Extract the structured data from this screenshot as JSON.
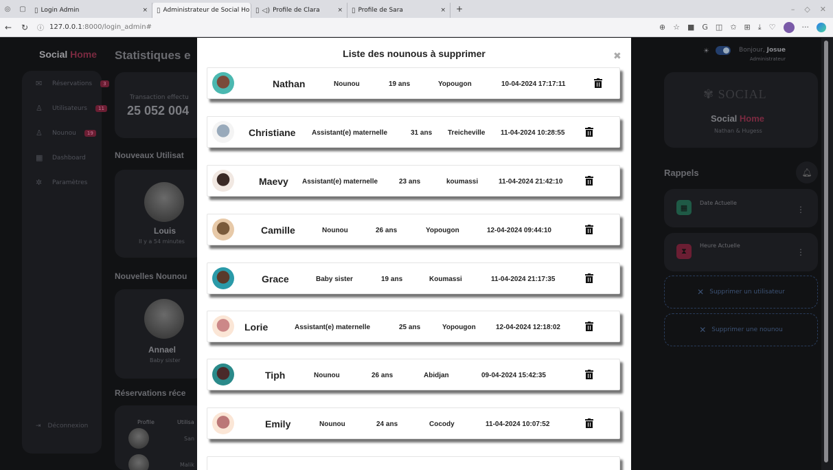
{
  "browser": {
    "tabs": [
      {
        "label": "Login Admin",
        "active": false
      },
      {
        "label": "Administrateur de Social Ho",
        "active": true
      },
      {
        "label": "Profile de Clara",
        "active": false
      },
      {
        "label": "Profile de Sara",
        "active": false
      }
    ],
    "url_host": "127.0.0.1",
    "url_path": ":8000/login_admin#"
  },
  "sidebar": {
    "brand_a": "Social",
    "brand_b": "Home",
    "items": [
      {
        "label": "Réservations",
        "badge": "3"
      },
      {
        "label": "Utilisateurs",
        "badge": "11"
      },
      {
        "label": "Nounou",
        "badge": "19"
      },
      {
        "label": "Dashboard",
        "badge": ""
      },
      {
        "label": "Paramètres",
        "badge": ""
      }
    ],
    "logout": "Déconnexion"
  },
  "main": {
    "title": "Statistiques e",
    "transaction_label": "Transaction effectu",
    "transaction_value": "25 052 004",
    "new_users_heading": "Nouveaux Utilisat",
    "new_user_name": "Louis",
    "new_user_time": "Il y a 54 minutes",
    "new_nannies_heading": "Nouvelles Nounou",
    "new_nanny_name": "Annael",
    "new_nanny_role": "Baby sister",
    "reservations_heading": "Réservations réce",
    "res_col_profile": "Profile",
    "res_col_user": "Utilisa",
    "res_row1": "San",
    "res_row2": "Malik"
  },
  "right": {
    "greeting_prefix": "Bonjour,",
    "user": "Josue",
    "role": "Administrateur",
    "brand_a": "Social",
    "brand_b": "Home",
    "brand_sub": "Nathan & Hugess",
    "rappels": "Rappels",
    "date_label": "Date Actuelle",
    "time_label": "Heure Actuelle",
    "delete_user": "Supprimer un utilisateur",
    "delete_nanny": "Supprimer une nounou"
  },
  "modal": {
    "title": "Liste des nounous à supprimer",
    "rows": [
      {
        "name": "Nathan",
        "role": "Nounou",
        "age": "19 ans",
        "city": "Yopougon",
        "date": "10-04-2024 17:17:11"
      },
      {
        "name": "Christiane",
        "role": "Assistant(e) maternelle",
        "age": "31 ans",
        "city": "Treicheville",
        "date": "11-04-2024 10:28:55"
      },
      {
        "name": "Maevy",
        "role": "Assistant(e) maternelle",
        "age": "23 ans",
        "city": "koumassi",
        "date": "11-04-2024 21:42:10"
      },
      {
        "name": "Camille",
        "role": "Nounou",
        "age": "26 ans",
        "city": "Yopougon",
        "date": "12-04-2024 09:44:10"
      },
      {
        "name": "Grace",
        "role": "Baby sister",
        "age": "19 ans",
        "city": "Koumassi",
        "date": "11-04-2024 21:17:35"
      },
      {
        "name": "Lorie",
        "role": "Assistant(e) maternelle",
        "age": "25 ans",
        "city": "Yopougon",
        "date": "12-04-2024 12:18:02"
      },
      {
        "name": "Tiph",
        "role": "Nounou",
        "age": "26 ans",
        "city": "Abidjan",
        "date": "09-04-2024 15:42:35"
      },
      {
        "name": "Emily",
        "role": "Nounou",
        "age": "24 ans",
        "city": "Cocody",
        "date": "11-04-2024 10:07:52"
      }
    ]
  },
  "colors": {
    "accent": "#e11d48",
    "modal_bg": "#ffffff",
    "app_bg": "#111214"
  }
}
